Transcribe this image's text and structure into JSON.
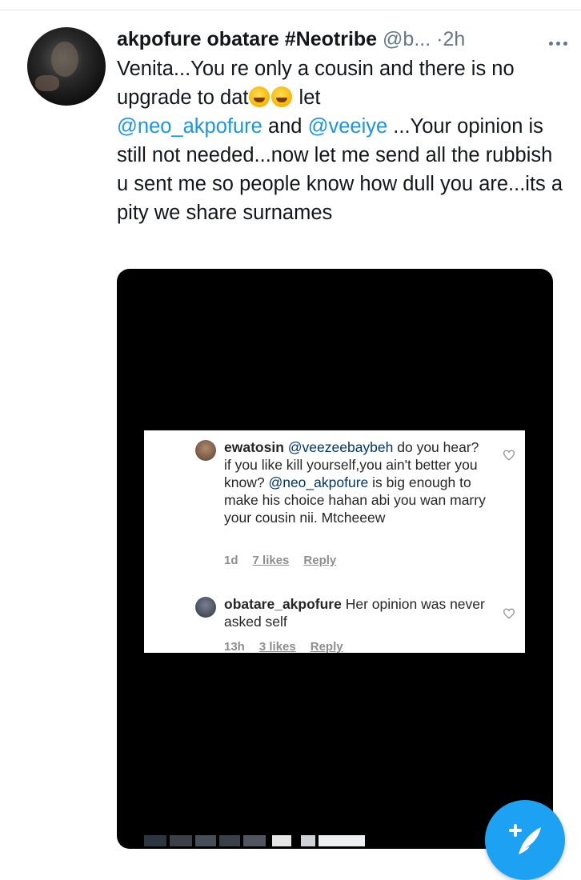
{
  "tweet": {
    "author_name": "akpofure obatare #Neotribe",
    "handle": "@b...",
    "separator": "·",
    "time": "2h",
    "text_parts": {
      "p1": "Venita...You re only a cousin and there is no upgrade to dat",
      "p2": " let",
      "mention1": "@neo_akpofure",
      "p3": " and ",
      "mention2": "@veeiye",
      "p4": " ...Your opinion is still not needed...now let me send all the rubbish u sent me so people know how dull you are...its a pity we share surnames"
    },
    "emoji_icons": [
      "rolling-laughing-emoji",
      "rolling-laughing-emoji"
    ]
  },
  "embedded_screenshot": {
    "comments": [
      {
        "user": "ewatosin",
        "mention": "@veezeebaybeh",
        "text_a": " do you hear? if you like kill yourself,you ain't better you know? ",
        "mention2": "@neo_akpofure",
        "text_b": " is big enough to make his choice hahan abi you wan marry your cousin nii. Mtcheeew",
        "time": "1d",
        "likes": "7 likes",
        "reply": "Reply"
      },
      {
        "user": "obatare_akpofure",
        "text": " Her opinion was never asked self",
        "time": "13h",
        "likes": "3 likes",
        "reply": "Reply"
      }
    ]
  },
  "colors": {
    "link": "#1b95e0",
    "fab": "#1da1f2",
    "secondary_text": "#657786"
  },
  "icons": {
    "more": "more-dots-icon",
    "compose": "compose-tweet-icon",
    "heart": "heart-outline-icon"
  }
}
